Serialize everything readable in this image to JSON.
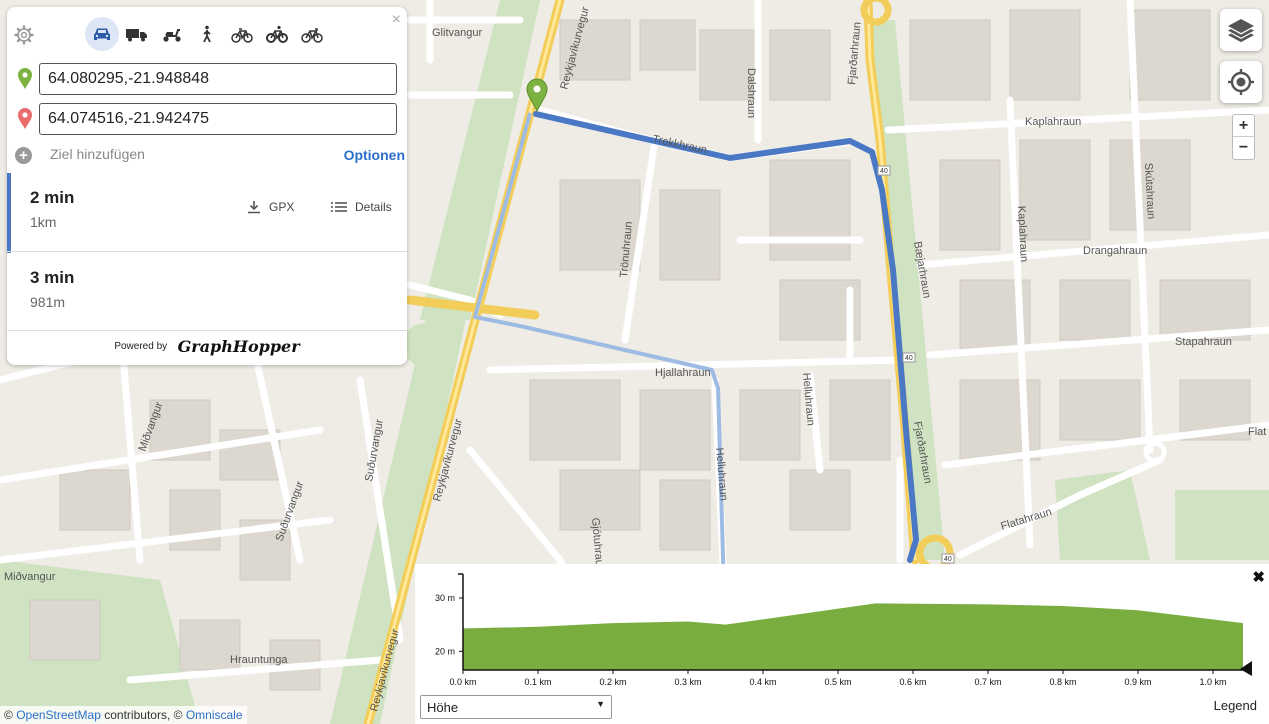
{
  "map": {
    "street_labels": {
      "glitvangur": "Glitvangur",
      "reykjavikurvegur": "Reykjavíkurvegur",
      "dalshraun": "Dalshraun",
      "fjardarhraun": "Fjarðarhraun",
      "kaplahraun": "Kaplahraun",
      "skutahraun": "Skútahraun",
      "trekkhraun": "Trekkhraun",
      "tronuhraun": "Trönuhraun",
      "drangahraun": "Drangahraun",
      "baejarhraun": "Bæjarhraun",
      "stapahraun": "Stapahraun",
      "hjallahraun": "Hjallahraun",
      "helluhraun": "Helluhraun",
      "midvangur": "Miðvangur",
      "sudurvangur": "Suðurvangur",
      "flatahraun": "Flatahraun",
      "flat": "Flat",
      "hrauntunga": "Hrauntunga",
      "gjotuhraun": "Gjótuhraun"
    },
    "road_shields": [
      "40",
      "40",
      "40"
    ],
    "route_colors": {
      "selected": "#4a78c5",
      "alternative": "#9dbbe3"
    },
    "marker_colors": {
      "start": "#7bb241",
      "end": "#e86c6c"
    }
  },
  "panel": {
    "close_symbol": "×",
    "vehicles": [
      "car-icon",
      "truck-icon",
      "scooter-icon",
      "foot-icon",
      "bike-icon",
      "mountainbike-icon",
      "racingbike-icon"
    ],
    "active_vehicle": "car-icon",
    "from_value": "64.080295,-21.948848",
    "to_value": "64.074516,-21.942475",
    "add_destination": "Ziel hinzufügen",
    "options_label": "Optionen",
    "routes": [
      {
        "time": "2 min",
        "distance": "1km",
        "gpx_label": "GPX",
        "details_label": "Details"
      },
      {
        "time": "3 min",
        "distance": "981m"
      }
    ],
    "powered_by": "Powered by",
    "logo_text": "GraphHopper"
  },
  "controls": {
    "zoom_in": "+",
    "zoom_out": "−"
  },
  "elevation": {
    "close_symbol": "✖",
    "select_value": "Höhe",
    "legend_label": "Legend",
    "fill_color": "#79ad3f",
    "chart_data": {
      "type": "area",
      "x": [
        0.0,
        0.1,
        0.2,
        0.3,
        0.35,
        0.4,
        0.55,
        0.7,
        0.8,
        0.9,
        1.04
      ],
      "y": [
        24.3,
        24.6,
        25.3,
        25.6,
        25.0,
        26.0,
        29.0,
        28.8,
        28.5,
        27.7,
        25.3
      ],
      "y_ticks": [
        "20 m",
        "30 m"
      ],
      "x_ticks": [
        "0.0 km",
        "0.1 km",
        "0.2 km",
        "0.3 km",
        "0.4 km",
        "0.5 km",
        "0.6 km",
        "0.7 km",
        "0.8 km",
        "0.9 km",
        "1.0 km"
      ],
      "xlim": [
        0,
        1.04
      ],
      "ylim": [
        16.5,
        34.5
      ]
    }
  },
  "attribution": {
    "prefix": "©",
    "osm": "OpenStreetMap",
    "contributors": "contributors, ©",
    "omniscale": "Omniscale"
  }
}
